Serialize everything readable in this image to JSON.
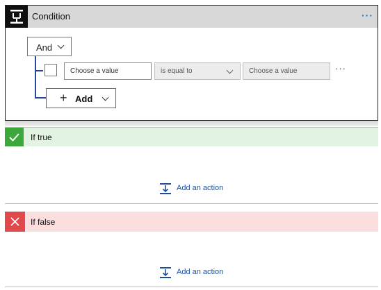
{
  "condition": {
    "title": "Condition",
    "more_label": "···",
    "group_operator": "And",
    "row": {
      "left_placeholder": "Choose a value",
      "operator": "is equal to",
      "right_placeholder": "Choose a value",
      "more_label": "···"
    },
    "add_label": "Add"
  },
  "if_true": {
    "label": "If true",
    "add_action_label": "Add an action",
    "color": "#3ca83c"
  },
  "if_false": {
    "label": "If false",
    "add_action_label": "Add an action",
    "color": "#e04a4a"
  },
  "colors": {
    "accent": "#1b4f9c",
    "true_bar": "#e2f3e2",
    "false_bar": "#fbdfdf"
  }
}
